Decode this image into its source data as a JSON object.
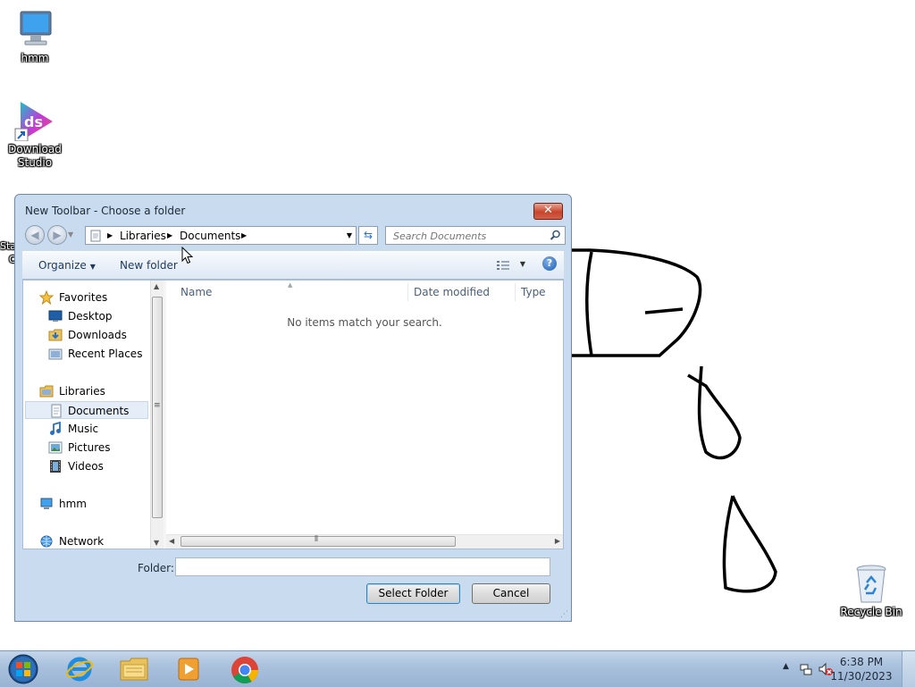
{
  "desktop": {
    "icons": [
      {
        "label": "hmm",
        "icon": "computer-icon"
      },
      {
        "label": "Download Studio",
        "icon": "download-studio-icon"
      },
      {
        "label": "Recycle Bin",
        "icon": "recycle-bin-icon"
      }
    ],
    "partial_labels": [
      "Sta",
      "C"
    ]
  },
  "dialog": {
    "title": "New Toolbar - Choose a folder",
    "close_label": "✕",
    "breadcrumb": [
      "Libraries",
      "Documents"
    ],
    "search_placeholder": "Search Documents",
    "toolbar": {
      "organize_label": "Organize",
      "new_folder_label": "New folder",
      "help_label": "?"
    },
    "nav_pane": {
      "favorites_header": "Favorites",
      "favorites": [
        "Desktop",
        "Downloads",
        "Recent Places"
      ],
      "libraries_header": "Libraries",
      "libraries": [
        "Documents",
        "Music",
        "Pictures",
        "Videos"
      ],
      "selected": "Documents",
      "computer": "hmm",
      "network": "Network"
    },
    "columns": [
      "Name",
      "Date modified",
      "Type"
    ],
    "empty_message": "No items match your search.",
    "folder_label": "Folder:",
    "folder_value": "",
    "select_button": "Select Folder",
    "cancel_button": "Cancel"
  },
  "taskbar": {
    "pinned": [
      "start-orb-icon",
      "internet-explorer-icon",
      "file-explorer-icon",
      "media-player-icon",
      "chrome-icon"
    ],
    "time": "6:38 PM",
    "date": "11/30/2023"
  },
  "colors": {
    "accent": "#2a70c0",
    "dialog_frame": "#c9dcef",
    "taskbar": "#a8c0dc",
    "close_button": "#c8442b"
  }
}
